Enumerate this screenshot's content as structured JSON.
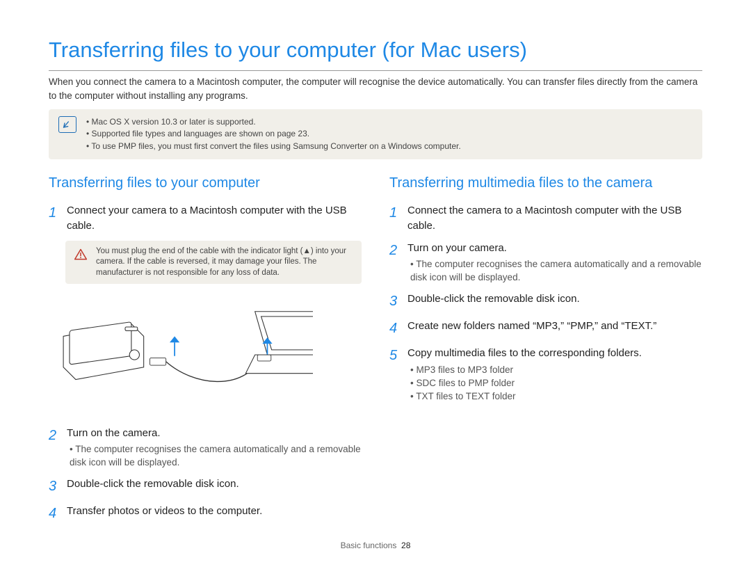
{
  "title": "Transferring files to your computer (for Mac users)",
  "intro": "When you connect the camera to a Macintosh computer, the computer will recognise the device automatically. You can transfer files directly from the camera to the computer without installing any programs.",
  "info_notes": [
    "Mac OS X version 10.3 or later is supported.",
    "Supported file types and languages are shown on page 23.",
    "To use PMP files, you must first convert the files using Samsung Converter on a Windows computer."
  ],
  "left": {
    "heading": "Transferring files to your computer",
    "steps": {
      "s1": {
        "num": "1",
        "text": "Connect your camera to a Macintosh computer with the USB cable."
      },
      "warn": "You must plug the end of the cable with the indicator light (▲) into your camera. If the cable is reversed, it may damage your files. The manufacturer is not responsible for any loss of data.",
      "s2": {
        "num": "2",
        "text": "Turn on the camera.",
        "bullets": [
          "The computer recognises the camera automatically and a removable disk icon will be displayed."
        ]
      },
      "s3": {
        "num": "3",
        "text": "Double-click the removable disk icon."
      },
      "s4": {
        "num": "4",
        "text": "Transfer photos or videos to the computer."
      }
    }
  },
  "right": {
    "heading": "Transferring multimedia files to the camera",
    "steps": {
      "s1": {
        "num": "1",
        "text": "Connect the camera to a Macintosh computer with the USB cable."
      },
      "s2": {
        "num": "2",
        "text": "Turn on your camera.",
        "bullets": [
          "The computer recognises the camera automatically and a removable disk icon will be displayed."
        ]
      },
      "s3": {
        "num": "3",
        "text": "Double-click the removable disk icon."
      },
      "s4": {
        "num": "4",
        "text": "Create new folders named “MP3,” “PMP,” and “TEXT.”"
      },
      "s5": {
        "num": "5",
        "text": "Copy multimedia files to the corresponding folders.",
        "bullets": [
          "MP3 files to MP3 folder",
          "SDC files to PMP folder",
          "TXT files to TEXT folder"
        ]
      }
    }
  },
  "footer": {
    "section": "Basic functions",
    "page": "28"
  }
}
